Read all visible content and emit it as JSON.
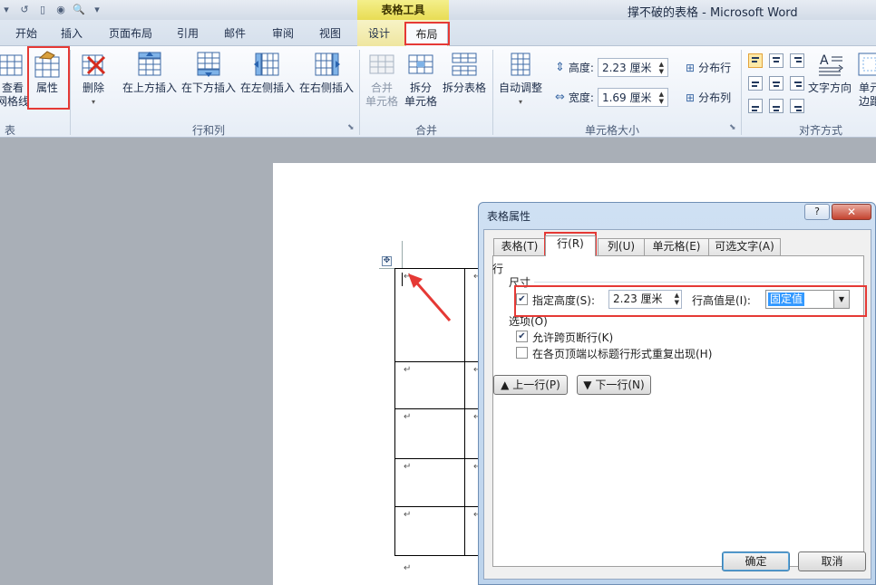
{
  "window": {
    "title": "撑不破的表格 - Microsoft Word",
    "context_tab_group": "表格工具"
  },
  "tabs": [
    {
      "label": "开始"
    },
    {
      "label": "插入"
    },
    {
      "label": "页面布局"
    },
    {
      "label": "引用"
    },
    {
      "label": "邮件"
    },
    {
      "label": "审阅"
    },
    {
      "label": "视图"
    },
    {
      "label": "设计"
    },
    {
      "label": "布局"
    }
  ],
  "ribbon": {
    "table_group": {
      "label": "表",
      "view_gridlines": [
        "查看",
        "网格线"
      ],
      "properties": "属性"
    },
    "rows_cols_group": {
      "label": "行和列",
      "delete": "删除",
      "insert_above": "在上方插入",
      "insert_below": "在下方插入",
      "insert_left": "在左侧插入",
      "insert_right": "在右侧插入"
    },
    "merge_group": {
      "label": "合并",
      "merge_cells": [
        "合并",
        "单元格"
      ],
      "split_cells": [
        "拆分",
        "单元格"
      ],
      "split_table": "拆分表格"
    },
    "cell_size_group": {
      "label": "单元格大小",
      "autofit": "自动调整",
      "height_label": "高度:",
      "height_value": "2.23 厘米",
      "width_label": "宽度:",
      "width_value": "1.69 厘米",
      "distribute_rows": "分布行",
      "distribute_cols": "分布列"
    },
    "alignment_group": {
      "label": "对齐方式",
      "text_direction": "文字方向",
      "cell_margins": [
        "单元",
        "边距"
      ]
    }
  },
  "dialog": {
    "title": "表格属性",
    "help": "?",
    "tabs": [
      "表格(T)",
      "行(R)",
      "列(U)",
      "单元格(E)",
      "可选文字(A)"
    ],
    "section_row": "行",
    "section_size": "尺寸",
    "specify_height_label": "指定高度(S):",
    "height_value": "2.23 厘米",
    "row_height_is_label": "行高值是(I):",
    "row_height_is_value": "固定值",
    "section_options": "选项(O)",
    "allow_break": "允许跨页断行(K)",
    "repeat_header": "在各页顶端以标题行形式重复出现(H)",
    "prev_row": "上一行(P)",
    "next_row": "下一行(N)",
    "ok": "确定",
    "cancel": "取消",
    "checkbox_state": {
      "specify_height": true,
      "allow_break": true,
      "repeat_header": false
    }
  },
  "document": {
    "paragraph_mark": "↵"
  }
}
